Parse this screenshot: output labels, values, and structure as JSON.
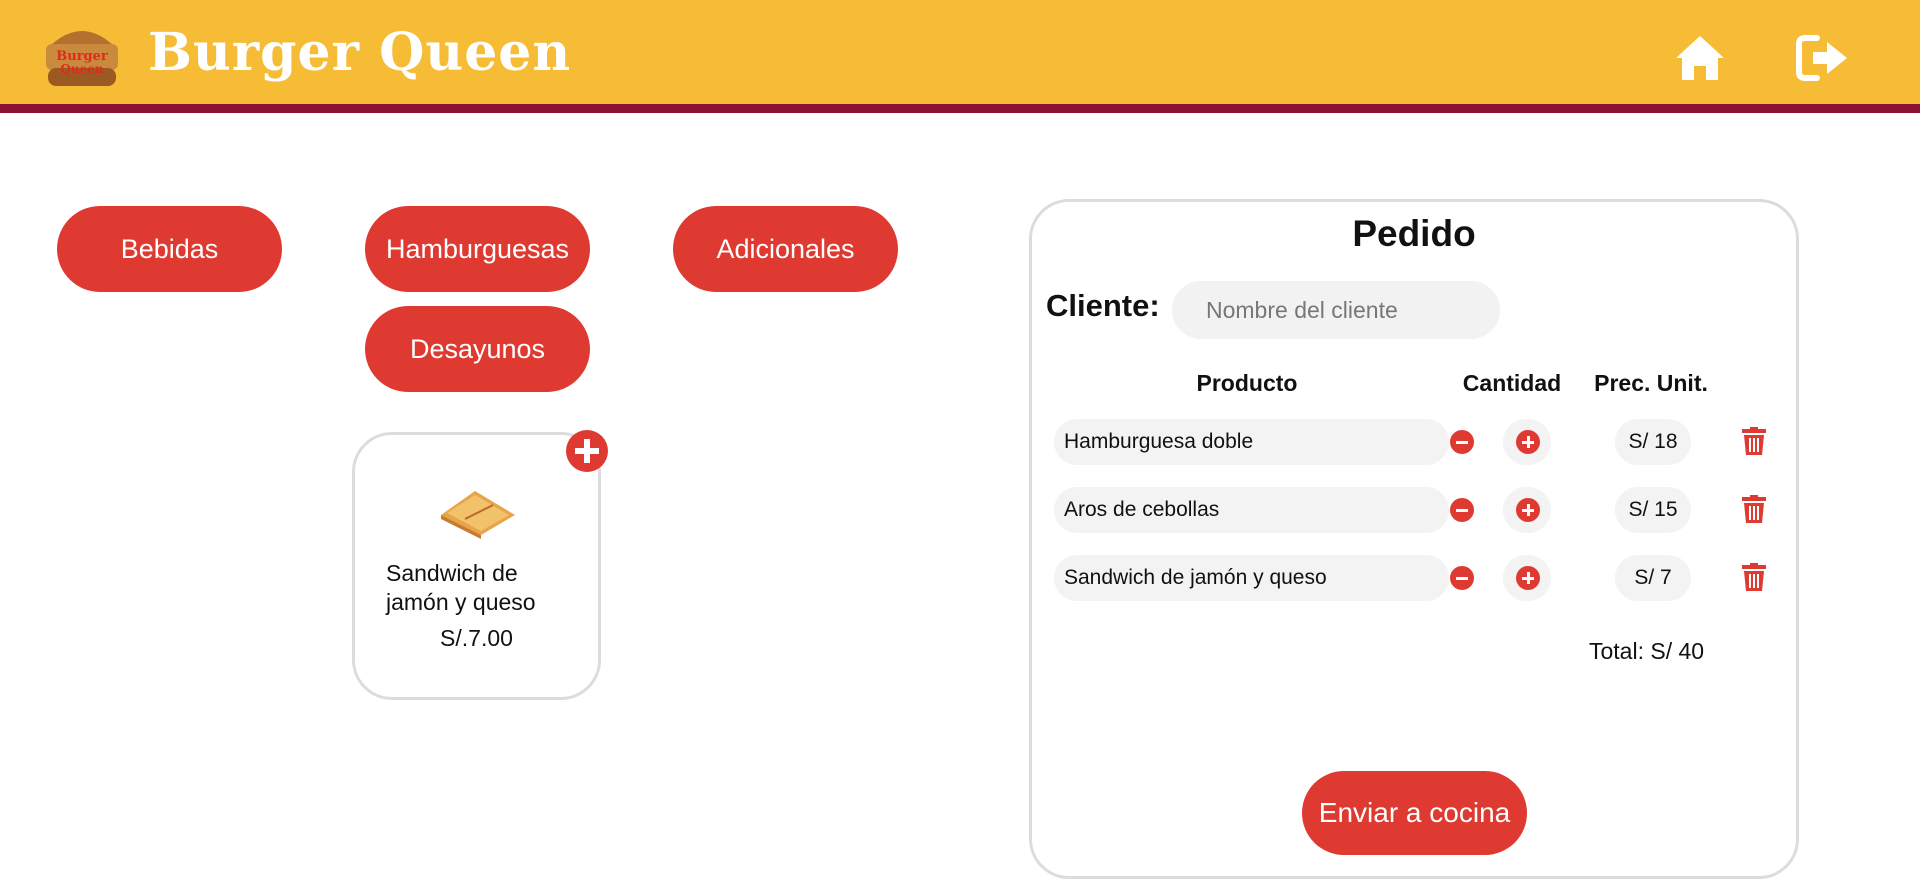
{
  "brand": {
    "name": "Burger Queen",
    "logo_text": "Burger Queen"
  },
  "header": {
    "home_icon": "home-icon",
    "logout_icon": "logout-icon"
  },
  "categories": [
    {
      "label": "Bebidas"
    },
    {
      "label": "Hamburguesas"
    },
    {
      "label": "Adicionales"
    },
    {
      "label": "Desayunos"
    }
  ],
  "product_card": {
    "name": "Sandwich de jamón y queso",
    "price": "S/.7.00",
    "add_icon": "plus-circle-icon"
  },
  "order": {
    "title": "Pedido",
    "client_label": "Cliente:",
    "client_placeholder": "Nombre del cliente",
    "client_value": "",
    "columns": {
      "product": "Producto",
      "quantity": "Cantidad",
      "unit_price": "Prec. Unit."
    },
    "items": [
      {
        "product": "Hamburguesa doble",
        "quantity": "",
        "unit_price": "S/ 18"
      },
      {
        "product": "Aros de cebollas",
        "quantity": "",
        "unit_price": "S/ 15"
      },
      {
        "product": "Sandwich de jamón y queso",
        "quantity": "",
        "unit_price": "S/ 7"
      }
    ],
    "total": "Total: S/ 40",
    "send_label": "Enviar a cocina"
  },
  "colors": {
    "header_bg": "#f6bc35",
    "header_border": "#8c1232",
    "accent_red": "#df3a31",
    "pill_bg": "#f3f3f3",
    "panel_border": "#dcdcdc"
  }
}
